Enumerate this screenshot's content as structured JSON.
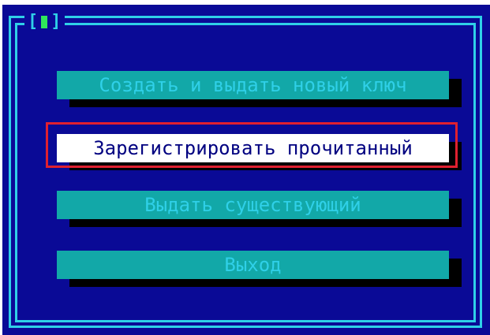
{
  "window": {
    "close_icon": "close-box-icon",
    "title_left": "[",
    "title_right": "]"
  },
  "menu": {
    "items": [
      {
        "label": "Создать и выдать новый ключ",
        "selected": false
      },
      {
        "label": "Зарегистрировать прочитанный",
        "selected": true
      },
      {
        "label": "Выдать существующий",
        "selected": false
      },
      {
        "label": "Выход",
        "selected": false
      }
    ]
  },
  "colors": {
    "background": "#0a0a96",
    "border": "#2fd0e8",
    "button_face": "#12a8a8",
    "button_text": "#2fd0e8",
    "selected_face": "#ffffff",
    "selected_text": "#000080",
    "shadow": "#000000",
    "highlight": "#e02030"
  }
}
